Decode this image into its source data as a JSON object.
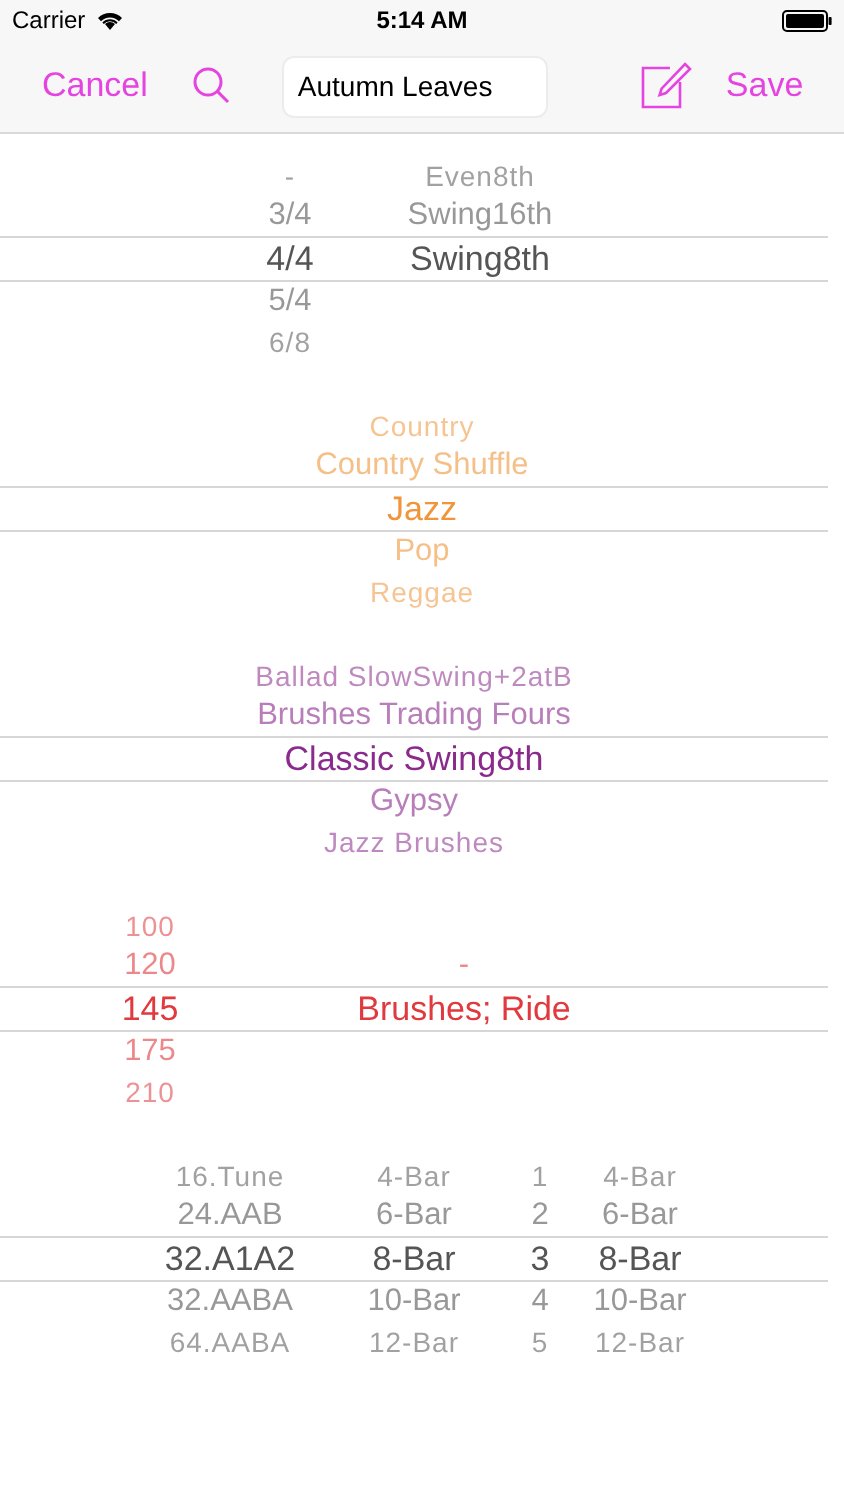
{
  "status_bar": {
    "carrier": "Carrier",
    "time": "5:14 AM"
  },
  "nav_bar": {
    "cancel": "Cancel",
    "search_value": "Autumn Leaves",
    "save": "Save"
  },
  "pickers": [
    {
      "color": "#555555",
      "columns": [
        {
          "items": [
            {
              "label": "-",
              "selected": false
            },
            {
              "label": "3/4",
              "selected": false
            },
            {
              "label": "4/4",
              "selected": true
            },
            {
              "label": "5/4",
              "selected": false
            },
            {
              "label": "6/8",
              "selected": false
            }
          ]
        },
        {
          "items": [
            {
              "label": "Even8th",
              "selected": false
            },
            {
              "label": "Swing16th",
              "selected": false
            },
            {
              "label": "Swing8th",
              "selected": true
            }
          ]
        }
      ]
    },
    {
      "color": "#f0953a",
      "columns": [
        {
          "items": [
            {
              "label": "Country",
              "selected": false
            },
            {
              "label": "Country Shuffle",
              "selected": false
            },
            {
              "label": "Jazz",
              "selected": true
            },
            {
              "label": "Pop",
              "selected": false
            },
            {
              "label": "Reggae",
              "selected": false
            }
          ]
        }
      ]
    },
    {
      "color": "#8a2a8c",
      "columns": [
        {
          "items": [
            {
              "label": "Ballad SlowSwing+2atB",
              "selected": false
            },
            {
              "label": "Brushes Trading Fours",
              "selected": false
            },
            {
              "label": "Classic Swing8th",
              "selected": true
            },
            {
              "label": "Gypsy",
              "selected": false
            },
            {
              "label": "Jazz Brushes",
              "selected": false
            }
          ]
        }
      ]
    },
    {
      "color": "#e0393e",
      "columns": [
        {
          "items": [
            {
              "label": "100",
              "selected": false
            },
            {
              "label": "120",
              "selected": false
            },
            {
              "label": "145",
              "selected": true
            },
            {
              "label": "175",
              "selected": false
            },
            {
              "label": "210",
              "selected": false
            }
          ]
        },
        {
          "items": [
            {
              "label": "-",
              "selected": false
            },
            {
              "label": "Brushes; Ride",
              "selected": true
            }
          ]
        }
      ]
    },
    {
      "color": "#555555",
      "columns": [
        {
          "items": [
            {
              "label": "16.Tune",
              "selected": false
            },
            {
              "label": "24.AAB",
              "selected": false
            },
            {
              "label": "32.A1A2",
              "selected": true
            },
            {
              "label": "32.AABA",
              "selected": false
            },
            {
              "label": "64.AABA",
              "selected": false
            }
          ]
        },
        {
          "items": [
            {
              "label": "4-Bar",
              "selected": false
            },
            {
              "label": "6-Bar",
              "selected": false
            },
            {
              "label": "8-Bar",
              "selected": true
            },
            {
              "label": "10-Bar",
              "selected": false
            },
            {
              "label": "12-Bar",
              "selected": false
            }
          ]
        },
        {
          "items": [
            {
              "label": "1",
              "selected": false
            },
            {
              "label": "2",
              "selected": false
            },
            {
              "label": "3",
              "selected": true
            },
            {
              "label": "4",
              "selected": false
            },
            {
              "label": "5",
              "selected": false
            }
          ]
        },
        {
          "items": [
            {
              "label": "4-Bar",
              "selected": false
            },
            {
              "label": "6-Bar",
              "selected": false
            },
            {
              "label": "8-Bar",
              "selected": true
            },
            {
              "label": "10-Bar",
              "selected": false
            },
            {
              "label": "12-Bar",
              "selected": false
            }
          ]
        }
      ]
    }
  ]
}
